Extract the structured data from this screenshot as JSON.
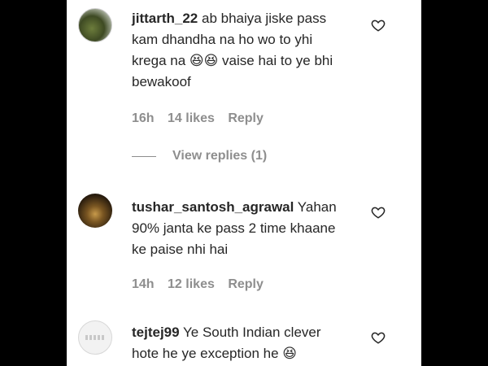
{
  "comments": [
    {
      "username": "jittarth_22",
      "text": "ab bhaiya jiske pass kam dhandha na ho wo to yhi krega na 😆😆 vaise hai to ye bhi bewakoof",
      "time": "16h",
      "likes": "14 likes",
      "reply_label": "Reply"
    },
    {
      "username": "tushar_santosh_agrawal",
      "text": "Yahan 90% janta ke pass 2 time khaane ke paise nhi hai",
      "time": "14h",
      "likes": "12 likes",
      "reply_label": "Reply"
    },
    {
      "username": "tejtej99",
      "text": "Ye South Indian clever hote he ye exception he 😆"
    }
  ],
  "view_replies_label": "View replies (1)",
  "icons": {
    "like": "heart-outline-icon"
  },
  "colors": {
    "text": "#262626",
    "muted": "#8e8e8e",
    "background": "#ffffff",
    "frame": "#000000"
  }
}
